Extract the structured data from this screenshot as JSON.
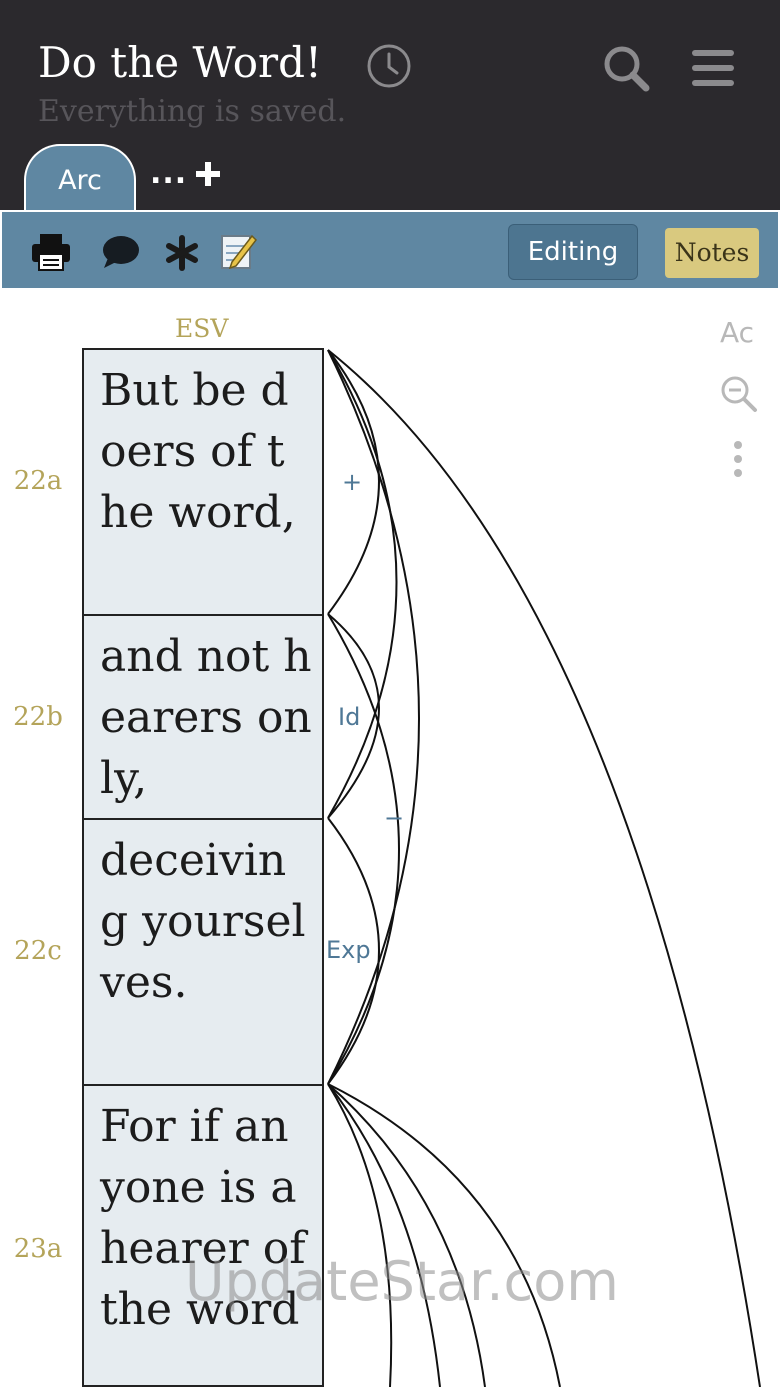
{
  "header": {
    "title": "Do the Word!",
    "status": "Everything is saved."
  },
  "tabs": {
    "active_label": "Arc",
    "more_label": "..."
  },
  "toolbar": {
    "editing_label": "Editing",
    "notes_label": "Notes"
  },
  "content": {
    "version": "ESV",
    "font_button": "Ac",
    "verses": [
      {
        "label": "22a",
        "text": "But be doers of the word,"
      },
      {
        "label": "22b",
        "text": "and not hearers only,"
      },
      {
        "label": "22c",
        "text": "deceiving yourselves."
      },
      {
        "label": "23a",
        "text": "For if anyone is a hearer of the word"
      }
    ],
    "relations": [
      "+",
      "Id",
      "−",
      "Exp"
    ]
  },
  "watermark": "UpdateStar.com",
  "colors": {
    "header_bg": "#2b292d",
    "toolbar_bg": "#5f87a2",
    "accent_gold": "#b4a45a",
    "notes_bg": "#d9c97f",
    "box_bg": "#e6ecf0",
    "relation_blue": "#4f7896"
  }
}
